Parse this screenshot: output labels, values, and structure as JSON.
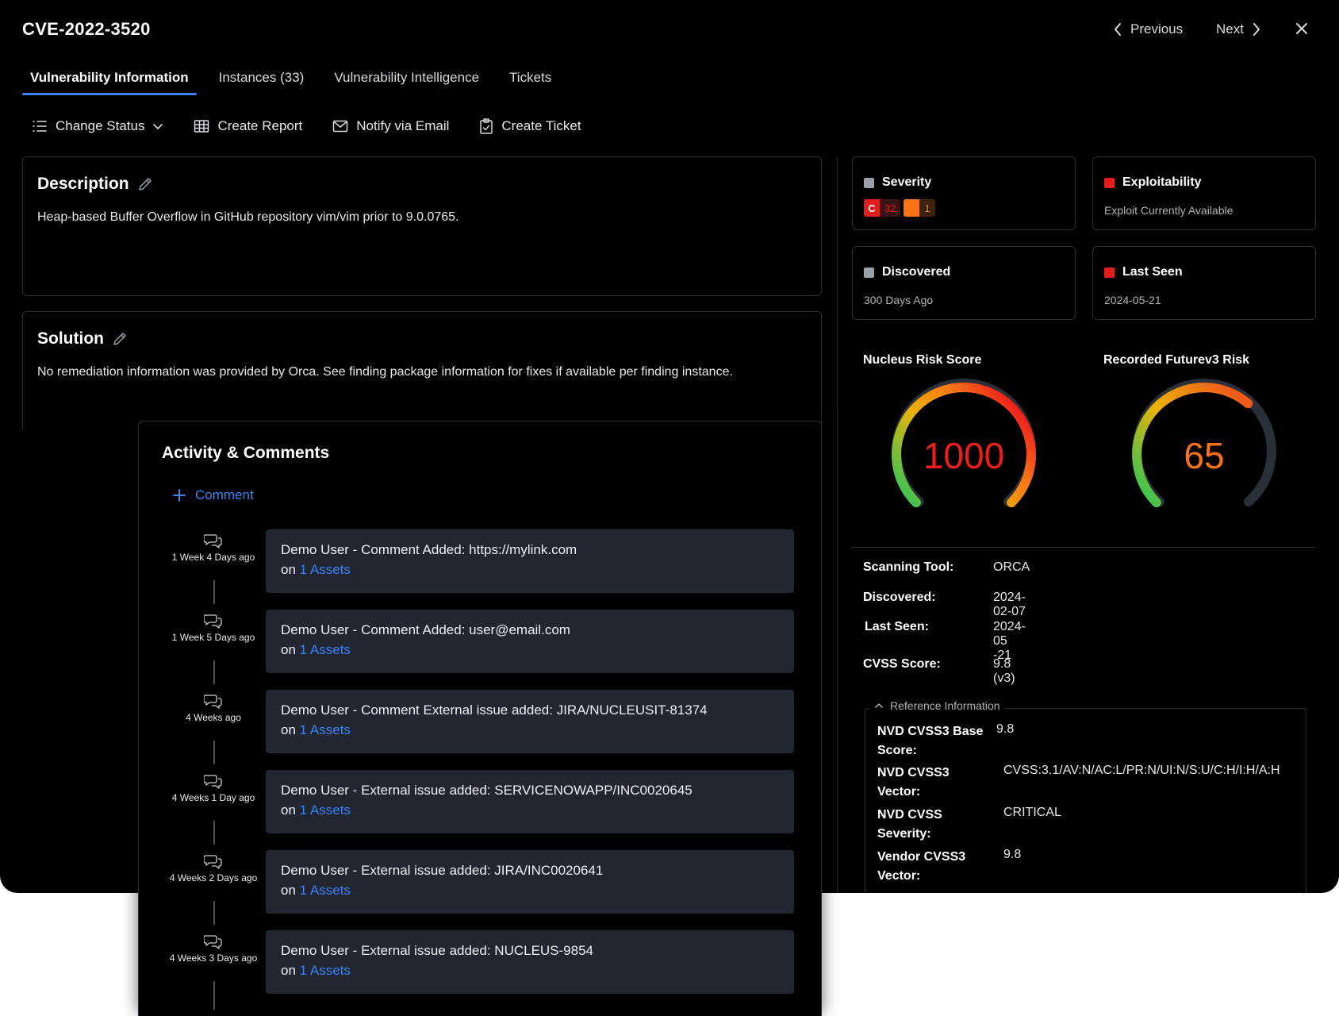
{
  "header": {
    "title": "CVE-2022-3520",
    "previous_label": "Previous",
    "next_label": "Next"
  },
  "tabs": [
    {
      "label": "Vulnerability Information",
      "active": true
    },
    {
      "label": "Instances (33)",
      "active": false
    },
    {
      "label": "Vulnerability Intelligence",
      "active": false
    },
    {
      "label": "Tickets",
      "active": false
    }
  ],
  "actions": {
    "change_status": "Change Status",
    "create_report": "Create Report",
    "notify_email": "Notify via Email",
    "create_ticket": "Create Ticket"
  },
  "description": {
    "title": "Description",
    "text": "Heap-based Buffer Overflow in GitHub repository vim/vim prior to 9.0.0765."
  },
  "solution": {
    "title": "Solution",
    "text": "No remediation information was provided by Orca. See finding package information for fixes if available per finding instance."
  },
  "stats": {
    "severity": {
      "label": "Severity",
      "critical_key": "C",
      "critical_count": "32",
      "high_count": "1"
    },
    "exploitability": {
      "label": "Exploitability",
      "value": "Exploit Currently Available"
    },
    "discovered": {
      "label": "Discovered",
      "value": "300 Days Ago"
    },
    "last_seen": {
      "label": "Last Seen",
      "value": "2024-05-21"
    }
  },
  "gauges": {
    "nucleus": {
      "title": "Nucleus Risk Score",
      "value": "1000",
      "fraction": 1.0
    },
    "futurev3": {
      "title": "Recorded Futurev3 Risk",
      "value": "65",
      "fraction": 0.65
    }
  },
  "details": {
    "scanning_tool_label": "Scanning Tool:",
    "scanning_tool": "ORCA",
    "discovered_label": "Discovered:",
    "discovered": "2024-02-07",
    "last_seen_label": "Last Seen:",
    "last_seen_a": "2024-05",
    "last_seen_b": "-21",
    "cvss_label": "CVSS Score:",
    "cvss": "9.8 (v3)"
  },
  "reference": {
    "legend": "Reference Information",
    "rows": [
      {
        "k1": "NVD CVSS3 Base",
        "k2": "Score:",
        "v": "9.8"
      },
      {
        "k1": "NVD CVSS3",
        "k2": "Vector:",
        "v": "CVSS:3.1/AV:N/AC:L/PR:N/UI:N/S:U/C:H/I:H/A:H"
      },
      {
        "k1": "NVD CVSS",
        "k2": "Severity:",
        "v": "CRITICAL"
      },
      {
        "k1": "Vendor CVSS3",
        "k2": "Vector:",
        "v": "9.8"
      }
    ]
  },
  "activity": {
    "title": "Activity & Comments",
    "comment_label": "Comment",
    "entries": [
      {
        "when": "1 Week 4 Days ago",
        "text": "Demo User - Comment Added: https://mylink.com",
        "on": "on",
        "assets": "1 Assets"
      },
      {
        "when": "1 Week 5 Days ago",
        "text": "Demo User - Comment Added: user@email.com",
        "on": "on",
        "assets": "1 Assets"
      },
      {
        "when": "4 Weeks ago",
        "text": "Demo User - Comment External issue added: JIRA/NUCLEUSIT-81374",
        "on": "on",
        "assets": "1 Assets"
      },
      {
        "when": "4 Weeks 1 Day ago",
        "text": "Demo User - External issue added: SERVICENOWAPP/INC0020645",
        "on": "on",
        "assets": "1 Assets"
      },
      {
        "when": "4 Weeks 2 Days ago",
        "text": "Demo User - External issue added: JIRA/INC0020641",
        "on": "on",
        "assets": "1 Assets"
      },
      {
        "when": "4 Weeks 3 Days ago",
        "text": "Demo User - External issue added: NUCLEUS-9854",
        "on": "on",
        "assets": "1 Assets"
      }
    ]
  },
  "colors": {
    "accent": "#3b82f6",
    "critical": "#e11d1d",
    "high": "#f97316",
    "muted_square": "#9aa0a8"
  }
}
